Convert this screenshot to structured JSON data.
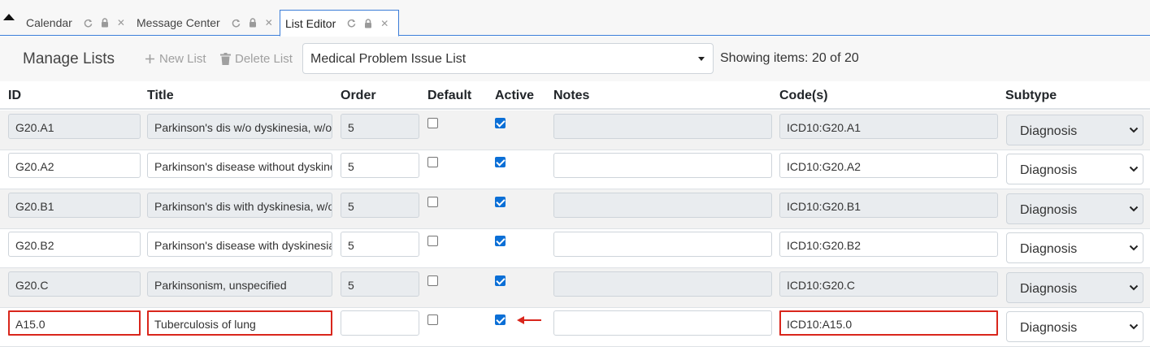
{
  "tabs": [
    {
      "label": "Calendar",
      "active": false
    },
    {
      "label": "Message Center",
      "active": false
    },
    {
      "label": "List Editor",
      "active": true
    }
  ],
  "toolbar": {
    "title": "Manage Lists",
    "new_list": "New List",
    "delete_list": "Delete List",
    "selected_list": "Medical Problem Issue List",
    "showing": "Showing items: 20 of 20"
  },
  "columns": [
    "ID",
    "Title",
    "Order",
    "Default",
    "Active",
    "Notes",
    "Code(s)",
    "Subtype"
  ],
  "rows": [
    {
      "id": "G20.A1",
      "title": "Parkinson's dis w/o dyskinesia, w/o mention of fluct",
      "order": "5",
      "default": false,
      "active": true,
      "notes": "",
      "codes": "ICD10:G20.A1",
      "subtype": "Diagnosis",
      "readonly": true
    },
    {
      "id": "G20.A2",
      "title": "Parkinson's disease without dyskinesia, with fluctuations",
      "order": "5",
      "default": false,
      "active": true,
      "notes": "",
      "codes": "ICD10:G20.A2",
      "subtype": "Diagnosis",
      "readonly": false
    },
    {
      "id": "G20.B1",
      "title": "Parkinson's dis with dyskinesia, w/o mention of fluct",
      "order": "5",
      "default": false,
      "active": true,
      "notes": "",
      "codes": "ICD10:G20.B1",
      "subtype": "Diagnosis",
      "readonly": true
    },
    {
      "id": "G20.B2",
      "title": "Parkinson's disease with dyskinesia, with fluctuations",
      "order": "5",
      "default": false,
      "active": true,
      "notes": "",
      "codes": "ICD10:G20.B2",
      "subtype": "Diagnosis",
      "readonly": false
    },
    {
      "id": "G20.C",
      "title": "Parkinsonism, unspecified",
      "order": "5",
      "default": false,
      "active": true,
      "notes": "",
      "codes": "ICD10:G20.C",
      "subtype": "Diagnosis",
      "readonly": true
    },
    {
      "id": "A15.0",
      "title": "Tuberculosis of lung",
      "order": "",
      "default": false,
      "active": true,
      "notes": "",
      "codes": "ICD10:A15.0",
      "subtype": "Diagnosis",
      "readonly": false,
      "highlighted": true
    }
  ],
  "colors": {
    "accent": "#3b7dd8",
    "highlight": "#d9261c",
    "checkbox": "#0b6fd6"
  }
}
